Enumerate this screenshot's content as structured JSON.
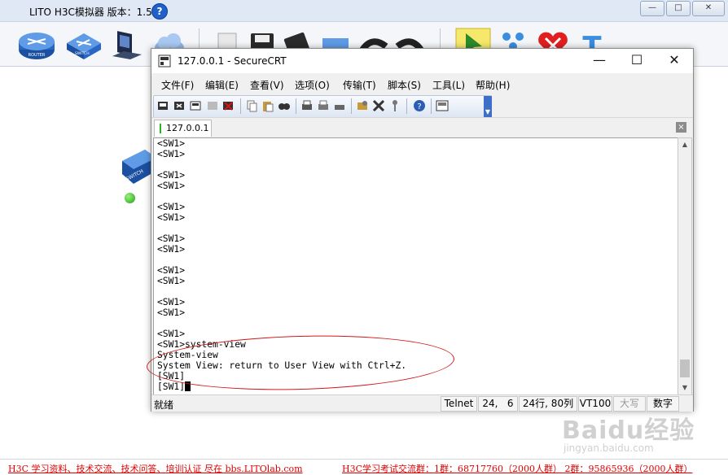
{
  "app": {
    "title": "LITO H3C模拟器 版本：1.5.2",
    "help_glyph": "?",
    "window_controls": {
      "minimize": "—",
      "restore": "□",
      "close": "✕"
    },
    "toolbar_icons": [
      "router-icon",
      "switch-icon",
      "pc-icon",
      "cloud-icon",
      "new-file-icon",
      "save-icon",
      "save-as-icon",
      "open-folder-icon",
      "undo-icon",
      "redo-icon",
      "select-pointer-icon",
      "connect-icon",
      "delete-icon",
      "text-icon"
    ],
    "router_caption": "ROUTER",
    "switch_caption": "SWITCH",
    "device_caption": "SWITCH",
    "text_tool_glyph": "T"
  },
  "crt": {
    "title": "127.0.0.1 - SecureCRT",
    "controls": {
      "minimize": "—",
      "maximize": "☐",
      "close": "✕"
    },
    "menu": [
      "文件(F)",
      "编辑(E)",
      "查看(V)",
      "选项(O)",
      "传输(T)",
      "脚本(S)",
      "工具(L)",
      "帮助(H)"
    ],
    "tab_label": "127.0.0.1",
    "tab_close": "×",
    "terminal_lines": [
      "<SW1>",
      "<SW1>",
      "",
      "<SW1>",
      "<SW1>",
      "",
      "<SW1>",
      "<SW1>",
      "",
      "<SW1>",
      "<SW1>",
      "",
      "<SW1>",
      "<SW1>",
      "",
      "<SW1>",
      "<SW1>",
      "",
      "<SW1>",
      "<SW1>system-view",
      "System-view",
      "System View: return to User View with Ctrl+Z.",
      "[SW1]",
      "[SW1]"
    ],
    "status": {
      "left": "就绪",
      "protocol": "Telnet",
      "cursor_pos": "24,   6",
      "size": "24行, 80列",
      "emulation": "VT100",
      "caps": "大写",
      "num": "数字"
    }
  },
  "footer": {
    "left_text": "H3C 学习资料、技术交流、技术问答、培训认证 尽在 bbs.LITOlab.com",
    "right_text": "H3C学习考试交流群：1群：68717760（2000人群） 2群：95865936（2000人群）"
  },
  "watermark": {
    "brand": "Baidu经验",
    "site": "jingyan.baidu.com"
  },
  "colors": {
    "accent_red": "#e00000",
    "highlight_oval": "#d01818",
    "toolbar_blue": "#3c6fc7"
  }
}
